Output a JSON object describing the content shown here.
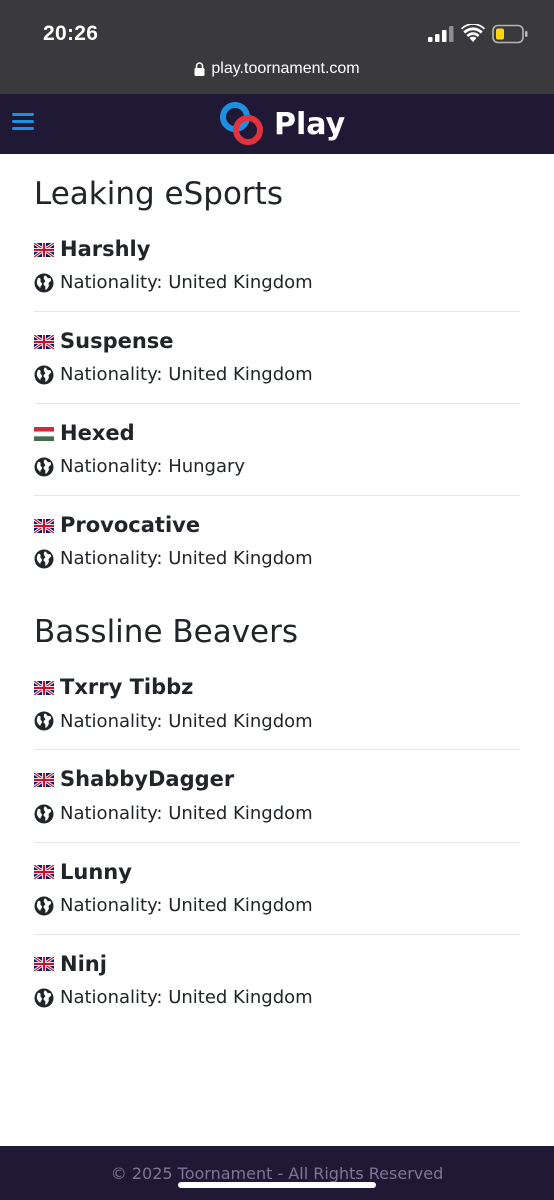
{
  "status_bar": {
    "time": "20:26",
    "url": "play.toornament.com"
  },
  "navbar": {
    "brand": "Play"
  },
  "teams": [
    {
      "name": "Leaking eSports",
      "players": [
        {
          "name": "Harshly",
          "flag": "gb",
          "nationality": "Nationality: United Kingdom"
        },
        {
          "name": "Suspense",
          "flag": "gb",
          "nationality": "Nationality: United Kingdom"
        },
        {
          "name": "Hexed",
          "flag": "hu",
          "nationality": "Nationality: Hungary"
        },
        {
          "name": "Provocative",
          "flag": "gb",
          "nationality": "Nationality: United Kingdom"
        }
      ]
    },
    {
      "name": "Bassline Beavers",
      "players": [
        {
          "name": "Txrry Tibbz",
          "flag": "gb",
          "nationality": "Nationality: United Kingdom"
        },
        {
          "name": "ShabbyDagger",
          "flag": "gb",
          "nationality": "Nationality: United Kingdom"
        },
        {
          "name": "Lunny",
          "flag": "gb",
          "nationality": "Nationality: United Kingdom"
        },
        {
          "name": "Ninj",
          "flag": "gb",
          "nationality": "Nationality: United Kingdom"
        }
      ]
    }
  ],
  "footer": {
    "text": "© 2025 Toornament - All Rights Reserved"
  },
  "colors": {
    "navbar_bg": "#201936",
    "hamburger": "#1e90e0",
    "logo_blue": "#1e90e0",
    "logo_red": "#e0333e"
  }
}
